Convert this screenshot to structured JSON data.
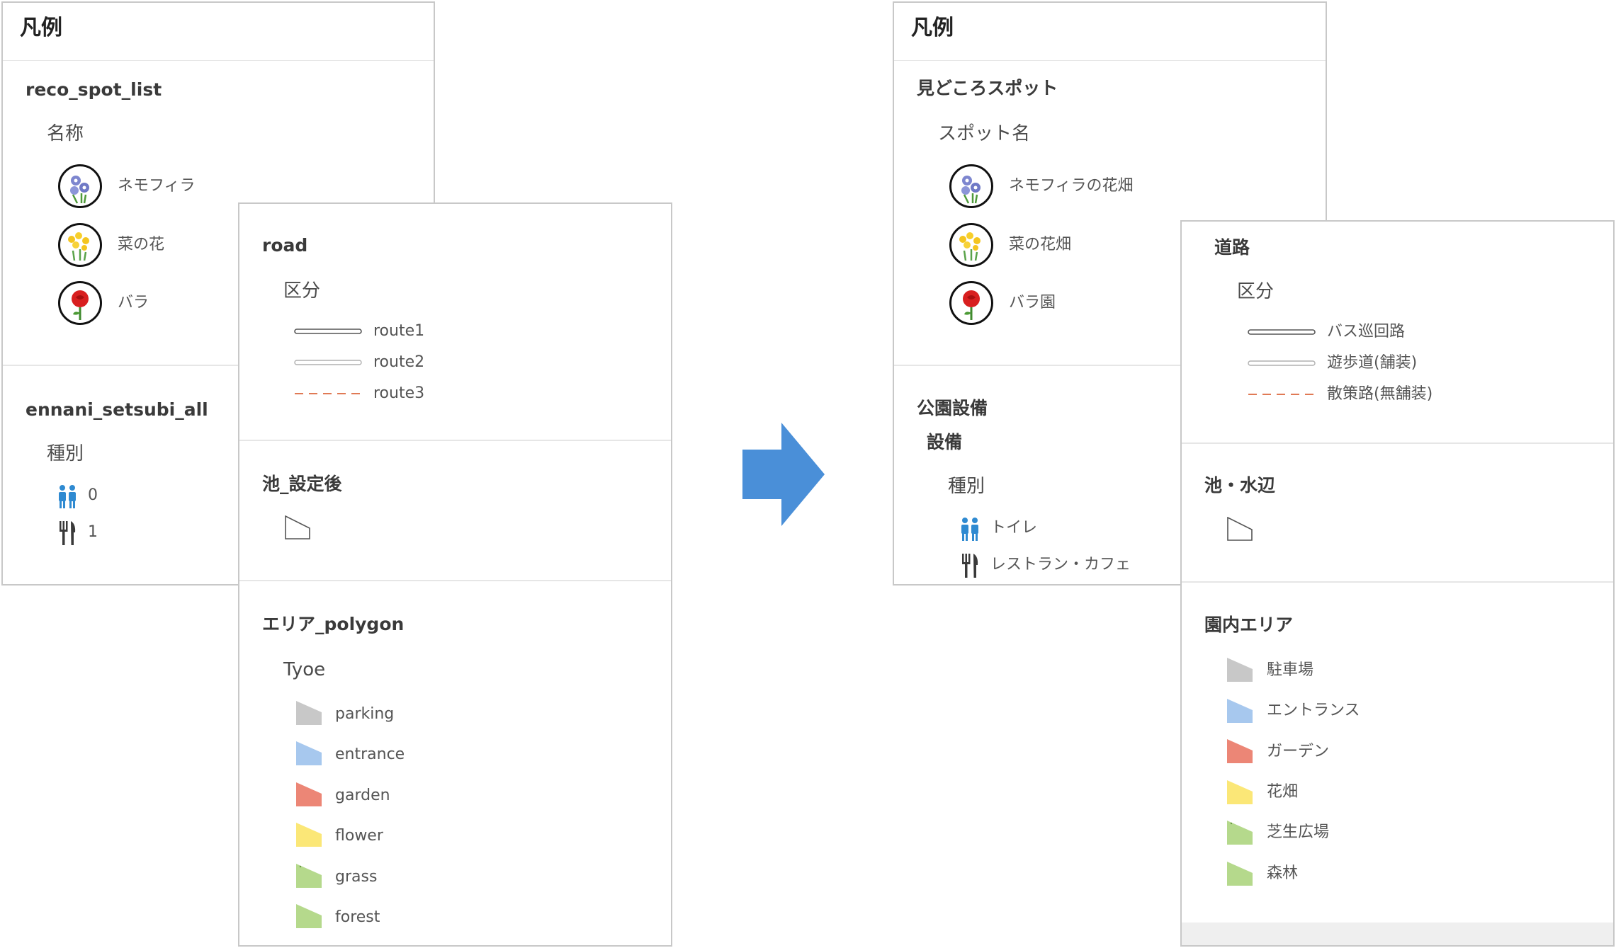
{
  "colors": {
    "parking": "#c8c8c8",
    "entrance": "#a7c8ee",
    "garden": "#ec8676",
    "flower": "#fbe777",
    "grass": "#b5d98c",
    "forest": "#b5d98c",
    "route3": "#e07a55",
    "arrow": "#4a8fd8",
    "toilet": "#2f8ad1",
    "restaurant": "#3a3a3a"
  },
  "left": {
    "legend_title": "凡例",
    "spot_layer": {
      "title": "reco_spot_list",
      "field": "名称",
      "items": [
        {
          "label": "ネモフィラ",
          "icon": "nemophila-icon"
        },
        {
          "label": "菜の花",
          "icon": "rapeseed-flower-icon"
        },
        {
          "label": "バラ",
          "icon": "rose-icon"
        }
      ]
    },
    "facility_layer": {
      "title": "ennani_setsubi_all",
      "field": "種別",
      "items": [
        {
          "label": "0",
          "icon": "restroom-icon"
        },
        {
          "label": "1",
          "icon": "restaurant-icon"
        }
      ]
    },
    "road_layer": {
      "title": "road",
      "field": "区分",
      "items": [
        {
          "label": "route1",
          "icon": "double-line-icon"
        },
        {
          "label": "route2",
          "icon": "light-line-icon"
        },
        {
          "label": "route3",
          "icon": "dashed-line-icon"
        }
      ]
    },
    "pond_layer": {
      "title": "池_設定後"
    },
    "area_layer": {
      "title": "エリア_polygon",
      "field": "Tyoe",
      "items": [
        {
          "label": "parking",
          "color_key": "parking"
        },
        {
          "label": "entrance",
          "color_key": "entrance"
        },
        {
          "label": "garden",
          "color_key": "garden"
        },
        {
          "label": "flower",
          "color_key": "flower"
        },
        {
          "label": "grass",
          "color_key": "grass"
        },
        {
          "label": "forest",
          "color_key": "forest"
        }
      ]
    }
  },
  "right": {
    "legend_title": "凡例",
    "spot_layer": {
      "title": "見どころスポット",
      "field": "スポット名",
      "items": [
        {
          "label": "ネモフィラの花畑",
          "icon": "nemophila-icon"
        },
        {
          "label": "菜の花畑",
          "icon": "rapeseed-flower-icon"
        },
        {
          "label": "バラ園",
          "icon": "rose-icon"
        }
      ]
    },
    "facility_layer": {
      "title": "公園設備",
      "subtitle": "設備",
      "field": "種別",
      "items": [
        {
          "label": "トイレ",
          "icon": "restroom-icon"
        },
        {
          "label": "レストラン・カフェ",
          "icon": "restaurant-icon"
        }
      ]
    },
    "road_layer": {
      "title": "道路",
      "field": "区分",
      "items": [
        {
          "label": "バス巡回路",
          "icon": "double-line-icon"
        },
        {
          "label": "遊歩道(舗装)",
          "icon": "light-line-icon"
        },
        {
          "label": "散策路(無舗装)",
          "icon": "dashed-line-icon"
        }
      ]
    },
    "pond_layer": {
      "title": "池・水辺"
    },
    "area_layer": {
      "title": "園内エリア",
      "items": [
        {
          "label": "駐車場",
          "color_key": "parking"
        },
        {
          "label": "エントランス",
          "color_key": "entrance"
        },
        {
          "label": "ガーデン",
          "color_key": "garden"
        },
        {
          "label": "花畑",
          "color_key": "flower"
        },
        {
          "label": "芝生広場",
          "color_key": "grass"
        },
        {
          "label": "森林",
          "color_key": "forest"
        }
      ]
    }
  }
}
